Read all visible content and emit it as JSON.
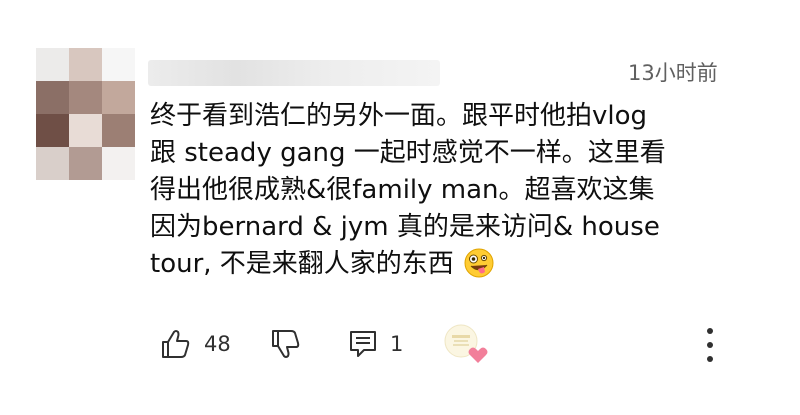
{
  "comment": {
    "timestamp": "13小时前",
    "text_lines": [
      "终于看到浩仁的另外一面。跟平时他拍vlog",
      "跟 steady gang 一起时感觉不一样。这里看",
      "得出他很成熟&很family man。超喜欢这集",
      "因为bernard & jym 真的是来访问& house",
      "tour, 不是来翻人家的东西"
    ],
    "emoji": "zany-face-emoji"
  },
  "actions": {
    "like_count": "48",
    "reply_count": "1",
    "like_icon": "thumbs-up-icon",
    "dislike_icon": "thumbs-down-icon",
    "reply_icon": "reply-comment-icon",
    "heart_icon": "creator-heart-icon",
    "more_icon": "more-vertical-icon"
  },
  "colors": {
    "text": "#0f0f0f",
    "secondary": "#606060",
    "heart": "#f27f9a"
  }
}
